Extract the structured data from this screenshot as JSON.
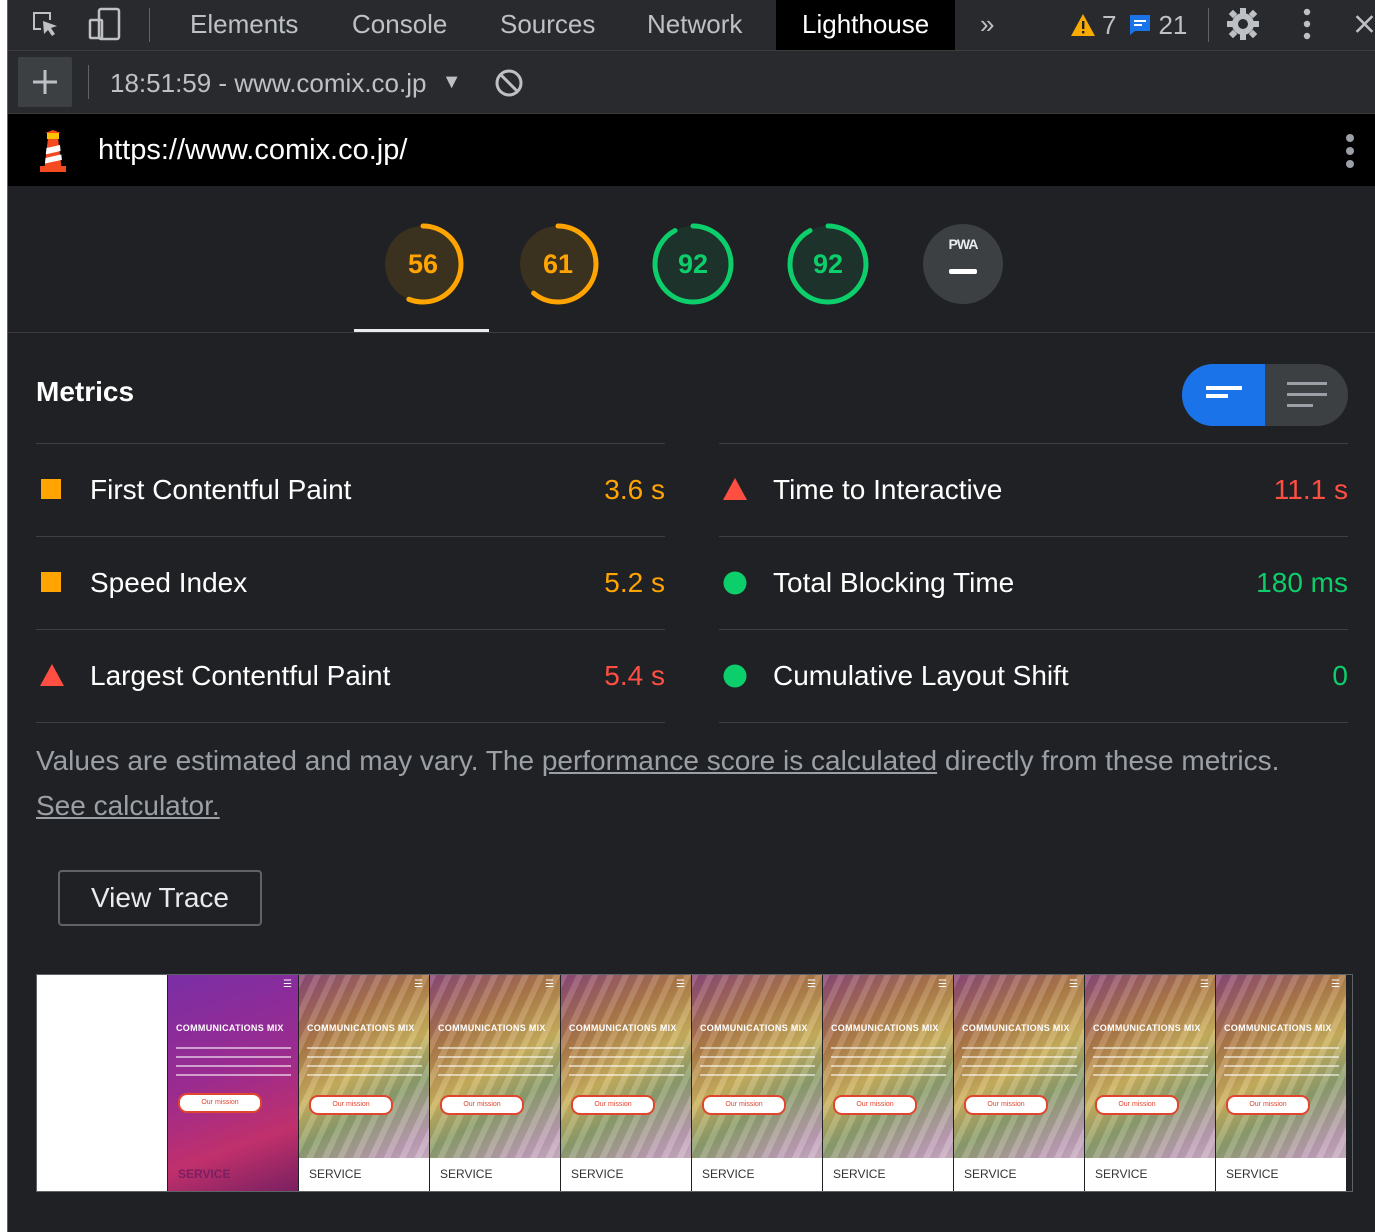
{
  "devtools": {
    "tabs": [
      "Elements",
      "Console",
      "Sources",
      "Network",
      "Lighthouse"
    ],
    "active_tab": "Lighthouse",
    "more_tabs": "»",
    "warnings_count": "7",
    "messages_count": "21"
  },
  "report_bar": {
    "selected_report": "18:51:59 - www.comix.co.jp"
  },
  "url_bar": {
    "url": "https://www.comix.co.jp/"
  },
  "gauges": [
    {
      "score": "56",
      "fraction": 0.56,
      "color": "#ffa400"
    },
    {
      "score": "61",
      "fraction": 0.61,
      "color": "#ffa400"
    },
    {
      "score": "92",
      "fraction": 0.92,
      "color": "#0cce6b"
    },
    {
      "score": "92",
      "fraction": 0.92,
      "color": "#0cce6b"
    },
    {
      "score": "PWA",
      "fraction": 0,
      "color": "#9aa0a6"
    }
  ],
  "metrics": {
    "title": "Metrics",
    "left": [
      {
        "label": "First Contentful Paint",
        "value": "3.6 s",
        "status": "average"
      },
      {
        "label": "Speed Index",
        "value": "5.2 s",
        "status": "average"
      },
      {
        "label": "Largest Contentful Paint",
        "value": "5.4 s",
        "status": "fail"
      }
    ],
    "right": [
      {
        "label": "Time to Interactive",
        "value": "11.1 s",
        "status": "fail"
      },
      {
        "label": "Total Blocking Time",
        "value": "180 ms",
        "status": "pass"
      },
      {
        "label": "Cumulative Layout Shift",
        "value": "0",
        "status": "pass"
      }
    ]
  },
  "note": {
    "text_1": "Values are estimated and may vary. The ",
    "link_1": "performance score is calculated",
    "text_2": " directly from these metrics. ",
    "link_2": "See calculator."
  },
  "view_trace_label": "View Trace",
  "filmstrip": {
    "frame_title": "COMMUNICATIONS MIX",
    "frame_button": "Our mission",
    "frame_footer": "SERVICE"
  },
  "colors": {
    "average": "#ffa400",
    "fail": "#ff4e42",
    "pass": "#0cce6b",
    "accent": "#1a73e8"
  }
}
